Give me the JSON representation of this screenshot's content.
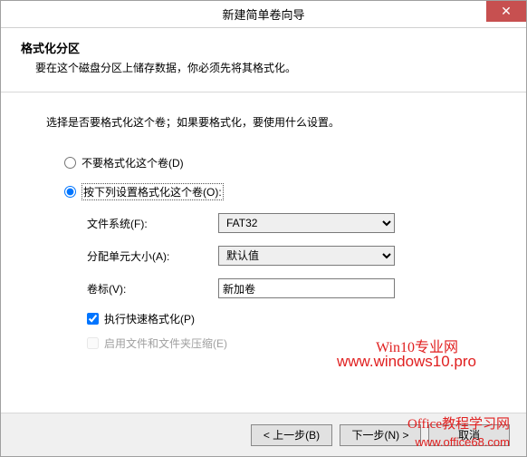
{
  "window": {
    "title": "新建简单卷向导",
    "close_glyph": "✕"
  },
  "header": {
    "title": "格式化分区",
    "desc": "要在这个磁盘分区上储存数据，你必须先将其格式化。"
  },
  "main": {
    "instruction": "选择是否要格式化这个卷；如果要格式化，要使用什么设置。",
    "radio_no_format": "不要格式化这个卷(D)",
    "radio_format": "按下列设置格式化这个卷(O):",
    "filesystem_label": "文件系统(F):",
    "filesystem_value": "FAT32",
    "alloc_label": "分配单元大小(A):",
    "alloc_value": "默认值",
    "volume_label": "卷标(V):",
    "volume_value": "新加卷",
    "quick_format": "执行快速格式化(P)",
    "compress": "启用文件和文件夹压缩(E)"
  },
  "watermarks": {
    "w1": "Win10专业网",
    "w2": "www.windows10.pro",
    "w3": "Office教程学习网",
    "w4": "www.office68.com"
  },
  "footer": {
    "back": "< 上一步(B)",
    "next": "下一步(N) >",
    "cancel": "取消"
  }
}
